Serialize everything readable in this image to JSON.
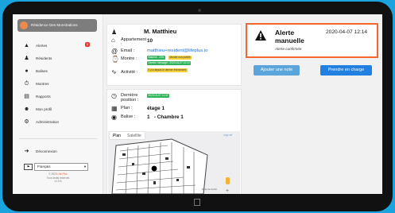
{
  "app": {
    "brand": "Résidence Des Monstrations"
  },
  "sidebar": {
    "items": [
      {
        "label": "Alertes",
        "icon": "warning-icon",
        "badge": "0"
      },
      {
        "label": "Résidents",
        "icon": "users-icon"
      },
      {
        "label": "Balises",
        "icon": "location-pin-icon"
      },
      {
        "label": "Montres",
        "icon": "watch-icon"
      },
      {
        "label": "Rapports",
        "icon": "document-icon"
      },
      {
        "label": "Mon profil",
        "icon": "user-icon"
      },
      {
        "label": "Administration",
        "icon": "gear-icon"
      }
    ],
    "logout_label": "Déconnexion",
    "language": "Français",
    "copyright_line1_prefix": "© 2020",
    "copyright_link": "Life Plus",
    "copyright_line2": "Tous droits réservés",
    "copyright_line3": "v1.0.6"
  },
  "resident": {
    "name": "M. Matthieu",
    "apartment_label": "Appartement :",
    "apartment_value": "10",
    "email_label": "Email :",
    "email_value": "matthieu+resident@lifeplus.io",
    "watch_label": "Montre :",
    "watch_battery": "Batterie : 23%",
    "watch_status": "Montre non portée",
    "watch_last_message": "Dernier message : 2020-04-07 12:14",
    "activity_label": "Activité :",
    "activity_value": "Il y a depuis le dernier événement"
  },
  "location": {
    "last_position_label": "Dernière position :",
    "last_position_value": "2020-04-07 11:43",
    "plan_label": "Plan :",
    "plan_value": "étage 1",
    "beacon_label": "Balise :",
    "beacon_value": "1   - Chambre 1",
    "map_tab_plan": "Plan",
    "map_tab_satellite": "Satellite",
    "map_corner_label": "urgs dé",
    "map_footer": "Ecran de touche"
  },
  "alert": {
    "title": "Alerte manuelle",
    "date": "2020-04-07 12:14",
    "status": "Alerte confirmée",
    "accent": "#f2662f"
  },
  "actions": {
    "add_note": "Ajouter une note",
    "take_charge": "Prendre en charge"
  },
  "colors": {
    "background": "#1aa3dc",
    "button_light": "#5aa6dc",
    "button_primary": "#2281e0"
  }
}
